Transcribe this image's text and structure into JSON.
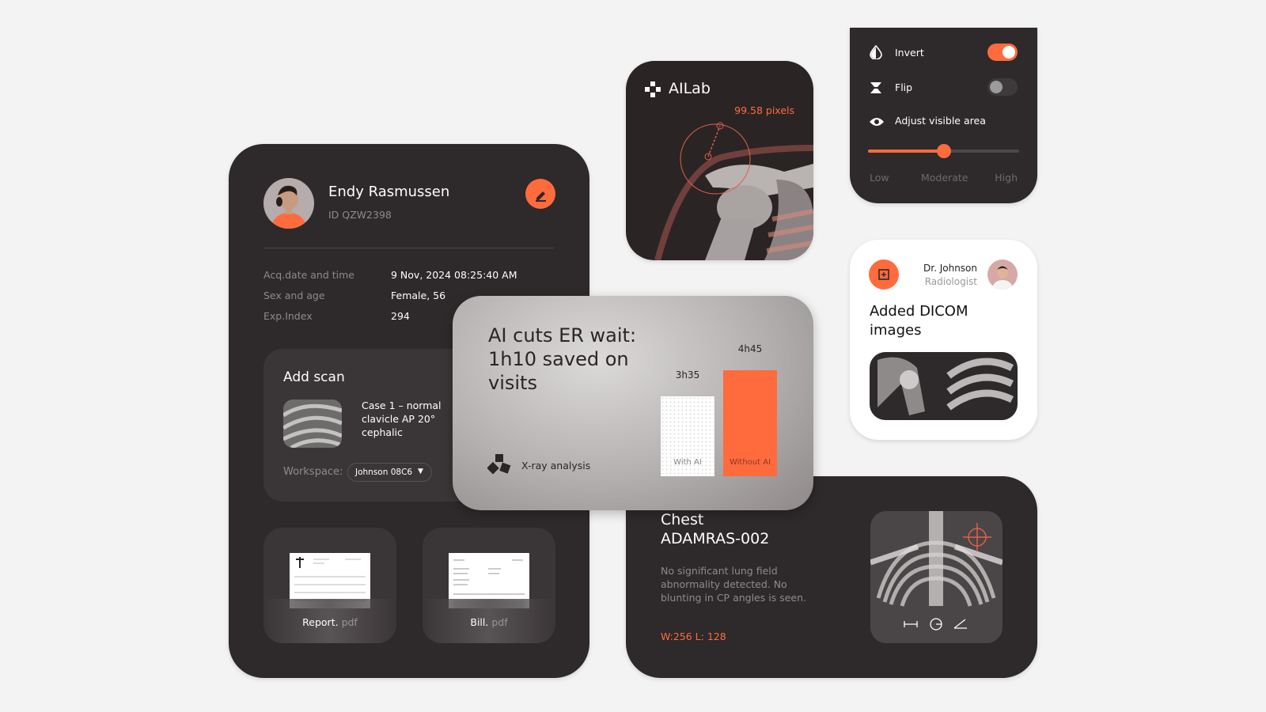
{
  "colors": {
    "accent": "#ff6b3d",
    "card_dark": "#2e292a",
    "background": "#f3f3f3"
  },
  "patient": {
    "name": "Endy Rasmussen",
    "id": "ID QZW2398",
    "edit_icon": "pencil-icon",
    "details": [
      {
        "label": "Acq.date and time",
        "value": "9 Nov, 2024 08:25:40 AM"
      },
      {
        "label": "Sex and age",
        "value": "Female, 56"
      },
      {
        "label": "Exp.Index",
        "value": "294"
      }
    ],
    "add_scan": {
      "title": "Add scan",
      "case_lines": [
        "Case 1 – normal",
        "clavicle AP 20°",
        "cephalic"
      ],
      "workspace_label": "Workspace:",
      "workspace_value": "Johnson 08C6"
    },
    "files": [
      {
        "name": "Report.",
        "ext": "pdf"
      },
      {
        "name": "Bill.",
        "ext": "pdf"
      }
    ]
  },
  "ailab": {
    "brand": "AILab",
    "measurement": "99.58 pixels"
  },
  "settings": {
    "invert": {
      "label": "Invert",
      "on": true
    },
    "flip": {
      "label": "Flip",
      "on": false
    },
    "adjust": {
      "label": "Adjust visible area",
      "level_percent": 50,
      "levels": [
        "Low",
        "Moderate",
        "High"
      ]
    }
  },
  "dicom": {
    "doctor": "Dr. Johnson",
    "role": "Radiologist",
    "title_lines": [
      "Added DICOM",
      "images"
    ]
  },
  "promo": {
    "title_lines": [
      "AI cuts ER wait:",
      "1h10 saved on",
      "visits"
    ],
    "footer": "X-ray analysis",
    "chart_data": {
      "type": "bar",
      "categories": [
        "With AI",
        "Without AI"
      ],
      "values": [
        215,
        285
      ],
      "value_labels": [
        "3h35",
        "4h45"
      ],
      "unit": "minutes"
    }
  },
  "chest": {
    "title": "Chest",
    "code": "ADAMRAS-002",
    "description_lines": [
      "No significant lung field",
      "abnormality detected. No",
      "blunting in CP angles is seen."
    ],
    "window": "W:256 L: 128",
    "tools": [
      "ruler-icon",
      "circle-measure-icon",
      "angle-icon"
    ]
  }
}
